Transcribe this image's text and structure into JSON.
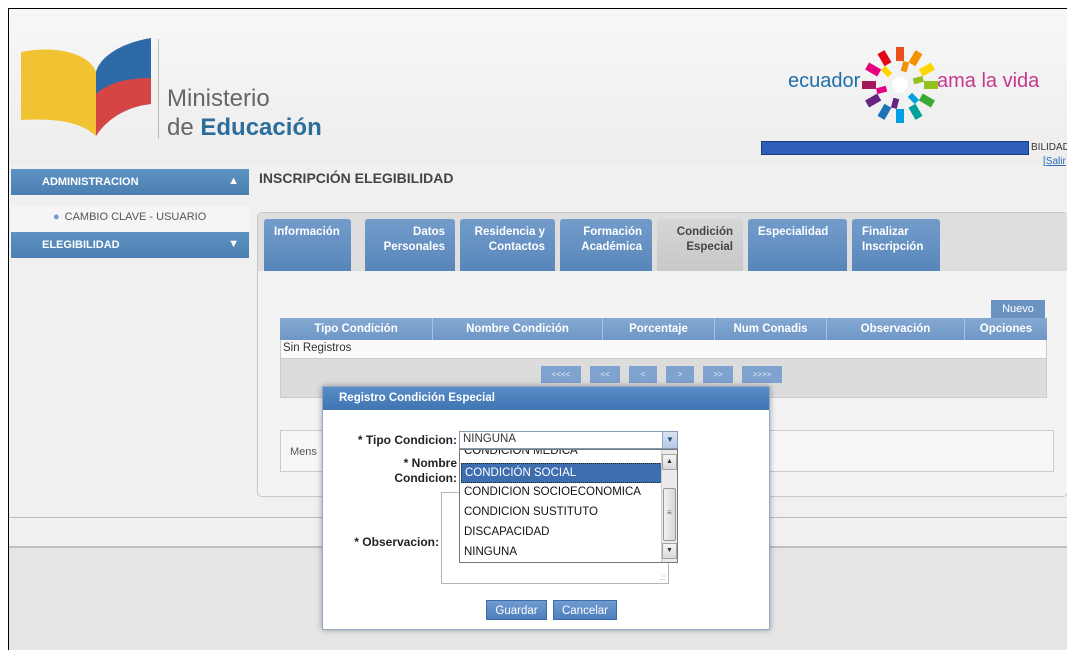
{
  "header": {
    "ministry_line1": "Ministerio",
    "ministry_line2_light": "de ",
    "ministry_line2_bold": "Educación",
    "ecuador": "ecuador",
    "ama_la_vida": "ama la vida",
    "user_role_partial": "BILIDAD)",
    "salir": "[Salir"
  },
  "sidebar": {
    "sections": [
      {
        "label": "ADMINISTRACION",
        "chevron": "⌃⌃",
        "expanded": true
      },
      {
        "label": "ELEGIBILIDAD",
        "chevron": "⌄⌄",
        "expanded": false
      }
    ],
    "items": [
      {
        "label": "CAMBIO CLAVE - USUARIO"
      }
    ]
  },
  "main": {
    "title": "INSCRIPCIÓN ELEGIBILIDAD",
    "tabs": [
      {
        "label": "Información",
        "active": false
      },
      {
        "label": "Datos Personales",
        "active": false
      },
      {
        "label": "Residencia y Contactos",
        "active": false
      },
      {
        "label": "Formación Académica",
        "active": false
      },
      {
        "label": "Condición Especial",
        "active": true
      },
      {
        "label": "Especialidad",
        "active": false
      },
      {
        "label": "Finalizar Inscripción",
        "active": false
      }
    ],
    "nuevo_label": "Nuevo",
    "table": {
      "columns": [
        "Tipo Condición",
        "Nombre Condición",
        "Porcentaje",
        "Num Conadis",
        "Observación",
        "Opciones"
      ],
      "empty_text": "Sin Registros",
      "pager": [
        "<<<<",
        "<<",
        "<",
        ">",
        ">>",
        ">>>>"
      ]
    },
    "message_label": "Mens"
  },
  "modal": {
    "title": "Registro Condición Especial",
    "tipo_label": "* Tipo Condicion:",
    "tipo_value": "NINGUNA",
    "nombre_label_1": "* Nombre",
    "nombre_label_2": "Condicion:",
    "observacion_label": "* Observacion:",
    "guardar": "Guardar",
    "cancelar": "Cancelar",
    "options": [
      {
        "label": "CONDICION MEDICA",
        "selected": false
      },
      {
        "label": "CONDICIÓN SOCIAL",
        "selected": true
      },
      {
        "label": "CONDICION SOCIOECONOMICA",
        "selected": false
      },
      {
        "label": "CONDICION SUSTITUTO",
        "selected": false
      },
      {
        "label": "DISCAPACIDAD",
        "selected": false
      },
      {
        "label": "NINGUNA",
        "selected": false
      }
    ]
  },
  "colors": {
    "accent_blue": "#5886ba",
    "header_blue": "#3f74b3",
    "selected_option": "#3d6fb0"
  }
}
